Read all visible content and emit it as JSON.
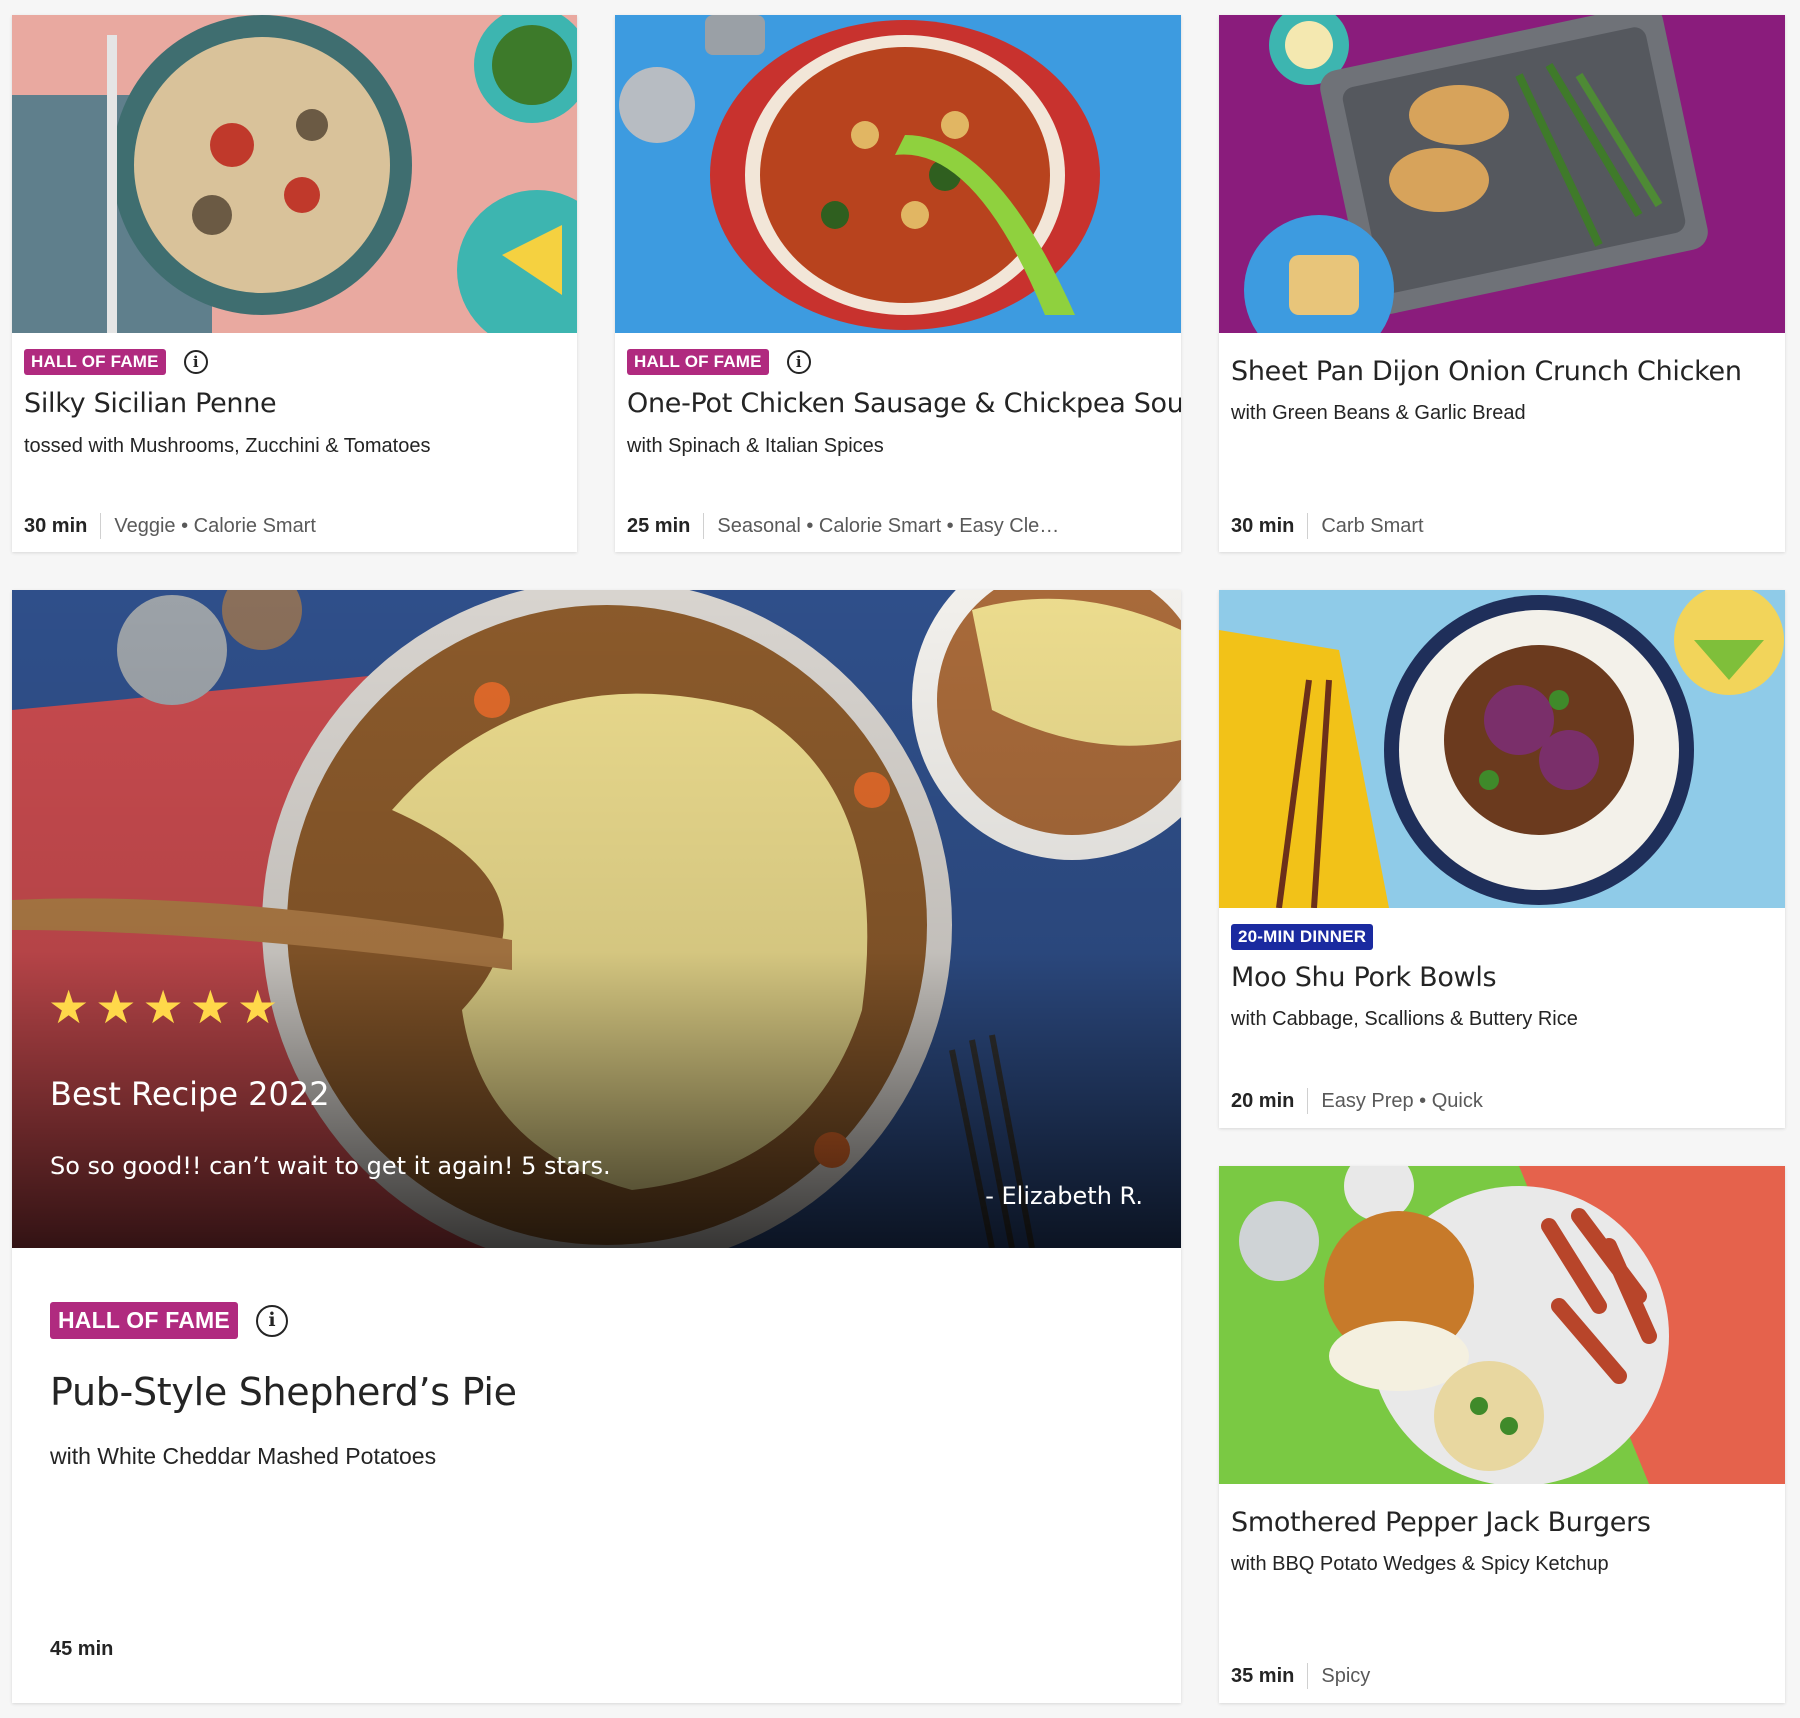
{
  "cards": [
    {
      "badge": "HALL OF FAME",
      "title": "Silky Sicilian Penne",
      "subtitle": "tossed with Mushrooms, Zucchini & Tomatoes",
      "time": "30 min",
      "tags": "Veggie • Calorie Smart"
    },
    {
      "badge": "HALL OF FAME",
      "title": "One-Pot Chicken Sausage & Chickpea Soup",
      "subtitle": "with Spinach & Italian Spices",
      "time": "25 min",
      "tags": "Seasonal • Calorie Smart • Easy Cle…"
    },
    {
      "title": "Sheet Pan Dijon Onion Crunch Chicken",
      "subtitle": "with Green Beans & Garlic Bread",
      "time": "30 min",
      "tags": "Carb Smart"
    },
    {
      "badge": "HALL OF FAME",
      "title": "Pub-Style Shepherd’s Pie",
      "subtitle": "with White Cheddar Mashed Potatoes",
      "time": "45 min",
      "rating_stars": 5,
      "review_heading": "Best Recipe 2022",
      "review_text": "So so good!! can’t wait to get it again! 5 stars.",
      "review_author": "- Elizabeth R."
    },
    {
      "badge": "20-MIN DINNER",
      "title": "Moo Shu Pork Bowls",
      "subtitle": "with Cabbage, Scallions & Buttery Rice",
      "time": "20 min",
      "tags": "Easy Prep • Quick"
    },
    {
      "title": "Smothered Pepper Jack Burgers",
      "subtitle": "with BBQ Potato Wedges & Spicy Ketchup",
      "time": "35 min",
      "tags": "Spicy"
    }
  ],
  "colors": {
    "hall_of_fame_badge": "#b02a7f",
    "twenty_min_badge": "#1a2aa0",
    "star": "#ffd84a"
  },
  "icons": {
    "info": "info-circle-icon",
    "star": "star-icon"
  }
}
